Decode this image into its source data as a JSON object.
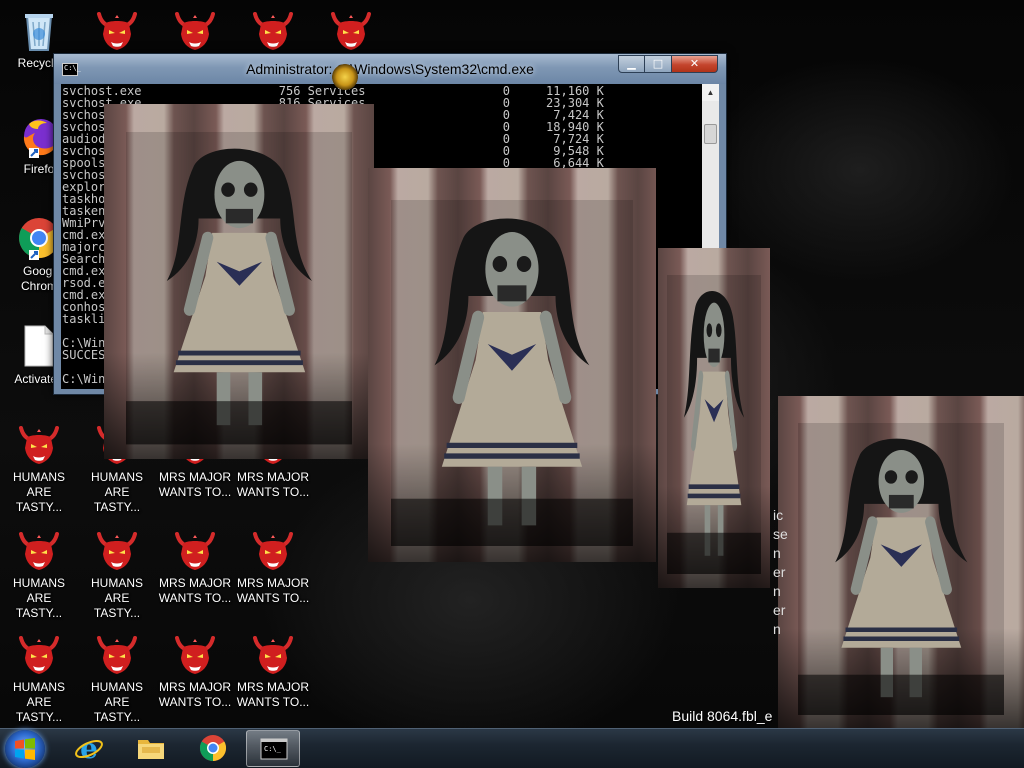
{
  "desktop": {
    "icons_left": [
      {
        "name": "recycle-bin",
        "label": "Recycle"
      },
      {
        "name": "firefox",
        "label": "Firefo"
      },
      {
        "name": "chrome",
        "label": "Googl\nChrom"
      },
      {
        "name": "file",
        "label": "Activated"
      }
    ],
    "devil_icons": [
      {
        "label": "HUMANS\nARE TASTY..."
      },
      {
        "label": "HUMANS\nARE TASTY..."
      },
      {
        "label": "MRS MAJOR\nWANTS TO..."
      },
      {
        "label": "MRS MAJOR\nWANTS TO..."
      },
      {
        "label": "HUMANS\nARE TASTY..."
      },
      {
        "label": "HUMANS\nARE TASTY..."
      },
      {
        "label": "MRS MAJOR\nWANTS TO..."
      },
      {
        "label": "MRS MAJOR\nWANTS TO..."
      },
      {
        "label": "HUMANS\nARE TASTY..."
      },
      {
        "label": "HUMANS\nARE TASTY..."
      },
      {
        "label": "MRS MAJOR\nWANTS TO..."
      },
      {
        "label": "MRS MAJOR\nWANTS TO..."
      }
    ],
    "build_text": "Build 8064.fbl_e",
    "side_fragment": "ic\nse\nn\ner\nn\ner\nn"
  },
  "cmd_window": {
    "title": "Administrator: C:\\Windows\\System32\\cmd.exe",
    "icon_text": "C:\\_",
    "buttons": {
      "minimize": "▁",
      "maximize": "□",
      "close": "✕"
    },
    "lines": [
      "svchost.exe                   756 Services                   0     11,160 K",
      "svchost.exe                   816 Services                   0     23,304 K",
      "svchost.exe                   884 Services                   0      7,424 K",
      "svchost.exe                   904 Services                   0     18,940 K",
      "audiodg.exe                   968 Services                   0      7,724 K",
      "svchost.exe                  1012 Services                   0      9,548 K",
      "spoolsv.exe                  1104 Services                   0      6,644 K",
      "svchost.exe                                                              K",
      "explorer.exe                                                             K",
      "taskhost.exe                                                             K",
      "taskeng.exe                                                              K",
      "WmiPrvSE.exe                                                             K",
      "cmd.exe                                                                  K",
      "majorc.exe",
      "SearchIndexer",
      "cmd.exe",
      "rsod.exe",
      "cmd.exe",
      "conhost.exe",
      "tasklist.exe",
      "",
      "C:\\Windows",
      "SUCCESS",
      "",
      "C:\\Windows"
    ]
  },
  "taskbar": {
    "items": [
      {
        "name": "internet-explorer"
      },
      {
        "name": "file-explorer"
      },
      {
        "name": "chrome"
      },
      {
        "name": "cmd",
        "active": true
      }
    ]
  }
}
